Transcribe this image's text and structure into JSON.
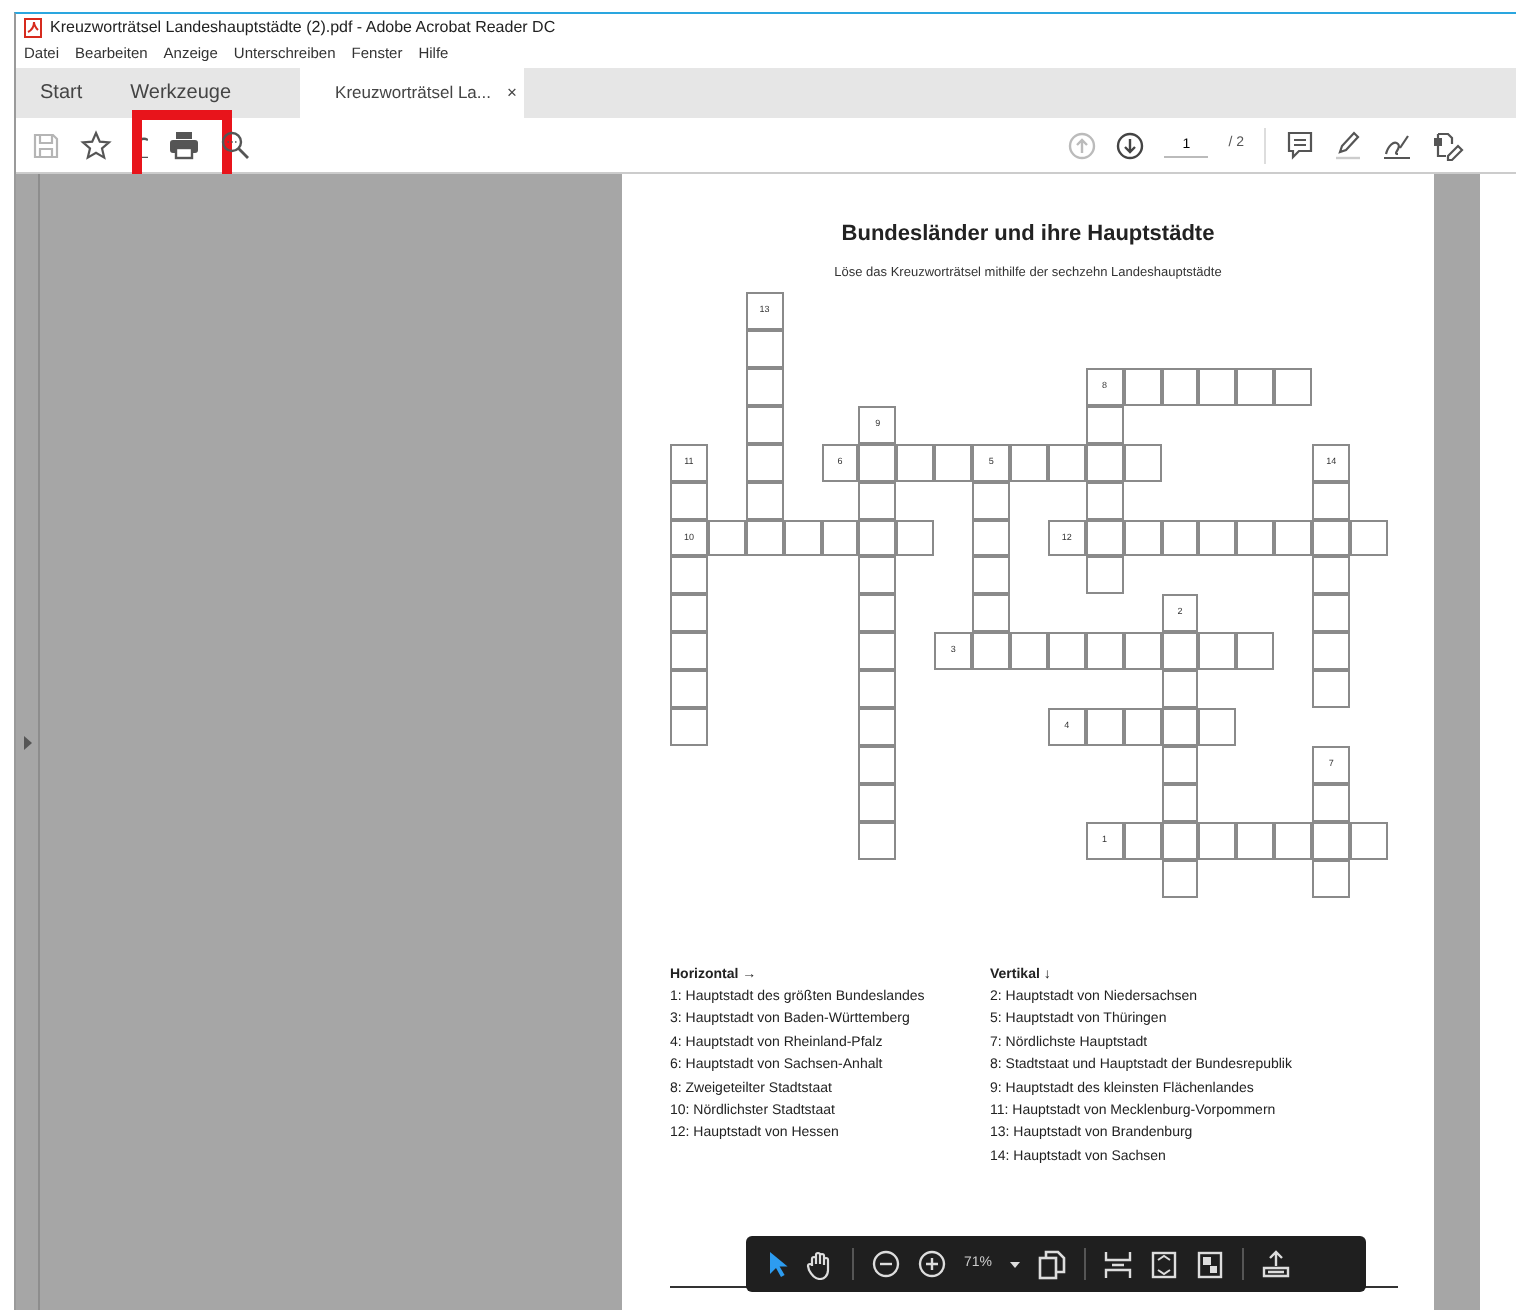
{
  "window": {
    "title": "Kreuzworträtsel Landeshauptstädte (2).pdf - Adobe Acrobat Reader DC"
  },
  "menu": [
    "Datei",
    "Bearbeiten",
    "Anzeige",
    "Unterschreiben",
    "Fenster",
    "Hilfe"
  ],
  "tabs": [
    {
      "label": "Start",
      "selected": false
    },
    {
      "label": "Werkzeuge",
      "selected": false
    },
    {
      "label": "Kreuzworträtsel La...",
      "selected": true,
      "close": "×"
    }
  ],
  "toolbar": {
    "left": [
      {
        "kind": "save",
        "disabled": true
      },
      {
        "kind": "star",
        "disabled": false
      },
      {
        "kind": "cloud",
        "disabled": false
      },
      {
        "kind": "print",
        "disabled": false,
        "highlighted": true
      },
      {
        "kind": "zoom",
        "disabled": false
      }
    ],
    "page_up": {
      "disabled": true
    },
    "page_down": {
      "disabled": false
    },
    "page": "1",
    "total": "/ 2",
    "right": [
      {
        "kind": "comment"
      },
      {
        "kind": "pen"
      },
      {
        "kind": "sign"
      },
      {
        "kind": "fill"
      }
    ]
  },
  "document": {
    "title": "Bundesländer und ihre Hauptstädte",
    "subtitle": "Löse das Kreuzworträtsel mithilfe der sechzehn Landeshauptstädte",
    "crossword": {
      "grid": [
        [
          {
            "kind": "gap"
          },
          {
            "kind": "gap"
          },
          {
            "kind": "box",
            "number": "13"
          }
        ],
        [
          {
            "kind": "gap"
          },
          {
            "kind": "gap"
          },
          {
            "kind": "box"
          }
        ],
        [
          {
            "kind": "gap"
          },
          {
            "kind": "gap"
          },
          {
            "kind": "box"
          },
          {
            "kind": "gap"
          },
          {
            "kind": "gap"
          },
          {
            "kind": "gap"
          },
          {
            "kind": "gap"
          },
          {
            "kind": "gap"
          },
          {
            "kind": "gap"
          },
          {
            "kind": "gap"
          },
          {
            "kind": "gap"
          },
          {
            "kind": "box",
            "number": "8"
          },
          {
            "kind": "box"
          },
          {
            "kind": "box"
          },
          {
            "kind": "box"
          },
          {
            "kind": "box"
          },
          {
            "kind": "box"
          }
        ],
        [
          {
            "kind": "gap"
          },
          {
            "kind": "gap"
          },
          {
            "kind": "box"
          },
          {
            "kind": "gap"
          },
          {
            "kind": "gap"
          },
          {
            "kind": "box",
            "number": "9"
          },
          {
            "kind": "gap"
          },
          {
            "kind": "gap"
          },
          {
            "kind": "gap"
          },
          {
            "kind": "gap"
          },
          {
            "kind": "gap"
          },
          {
            "kind": "box"
          }
        ],
        [
          {
            "kind": "box",
            "number": "11"
          },
          {
            "kind": "gap"
          },
          {
            "kind": "box"
          },
          {
            "kind": "gap"
          },
          {
            "kind": "box",
            "number": "6"
          },
          {
            "kind": "box"
          },
          {
            "kind": "box"
          },
          {
            "kind": "box"
          },
          {
            "kind": "box",
            "number": "5"
          },
          {
            "kind": "box"
          },
          {
            "kind": "box"
          },
          {
            "kind": "box"
          },
          {
            "kind": "box"
          },
          {
            "kind": "gap"
          },
          {
            "kind": "gap"
          },
          {
            "kind": "gap"
          },
          {
            "kind": "gap"
          },
          {
            "kind": "box",
            "number": "14"
          }
        ],
        [
          {
            "kind": "box"
          },
          {
            "kind": "gap"
          },
          {
            "kind": "box"
          },
          {
            "kind": "gap"
          },
          {
            "kind": "gap"
          },
          {
            "kind": "box"
          },
          {
            "kind": "gap"
          },
          {
            "kind": "gap"
          },
          {
            "kind": "box"
          },
          {
            "kind": "gap"
          },
          {
            "kind": "gap"
          },
          {
            "kind": "box"
          },
          {
            "kind": "gap"
          },
          {
            "kind": "gap"
          },
          {
            "kind": "gap"
          },
          {
            "kind": "gap"
          },
          {
            "kind": "gap"
          },
          {
            "kind": "box"
          }
        ],
        [
          {
            "kind": "box",
            "number": "10"
          },
          {
            "kind": "box"
          },
          {
            "kind": "box"
          },
          {
            "kind": "box"
          },
          {
            "kind": "box"
          },
          {
            "kind": "box"
          },
          {
            "kind": "box"
          },
          {
            "kind": "gap"
          },
          {
            "kind": "box"
          },
          {
            "kind": "gap"
          },
          {
            "kind": "box",
            "number": "12"
          },
          {
            "kind": "box"
          },
          {
            "kind": "box"
          },
          {
            "kind": "box"
          },
          {
            "kind": "box"
          },
          {
            "kind": "box"
          },
          {
            "kind": "box"
          },
          {
            "kind": "box"
          },
          {
            "kind": "box"
          }
        ],
        [
          {
            "kind": "box"
          },
          {
            "kind": "gap"
          },
          {
            "kind": "gap"
          },
          {
            "kind": "gap"
          },
          {
            "kind": "gap"
          },
          {
            "kind": "box"
          },
          {
            "kind": "gap"
          },
          {
            "kind": "gap"
          },
          {
            "kind": "box"
          },
          {
            "kind": "gap"
          },
          {
            "kind": "gap"
          },
          {
            "kind": "box"
          },
          {
            "kind": "gap"
          },
          {
            "kind": "gap"
          },
          {
            "kind": "gap"
          },
          {
            "kind": "gap"
          },
          {
            "kind": "gap"
          },
          {
            "kind": "box"
          }
        ],
        [
          {
            "kind": "box"
          },
          {
            "kind": "gap"
          },
          {
            "kind": "gap"
          },
          {
            "kind": "gap"
          },
          {
            "kind": "gap"
          },
          {
            "kind": "box"
          },
          {
            "kind": "gap"
          },
          {
            "kind": "gap"
          },
          {
            "kind": "box"
          },
          {
            "kind": "gap"
          },
          {
            "kind": "gap"
          },
          {
            "kind": "gap"
          },
          {
            "kind": "gap"
          },
          {
            "kind": "box",
            "number": "2"
          },
          {
            "kind": "gap"
          },
          {
            "kind": "gap"
          },
          {
            "kind": "gap"
          },
          {
            "kind": "box"
          }
        ],
        [
          {
            "kind": "box"
          },
          {
            "kind": "gap"
          },
          {
            "kind": "gap"
          },
          {
            "kind": "gap"
          },
          {
            "kind": "gap"
          },
          {
            "kind": "box"
          },
          {
            "kind": "gap"
          },
          {
            "kind": "box",
            "number": "3"
          },
          {
            "kind": "box"
          },
          {
            "kind": "box"
          },
          {
            "kind": "box"
          },
          {
            "kind": "box"
          },
          {
            "kind": "box"
          },
          {
            "kind": "box"
          },
          {
            "kind": "box"
          },
          {
            "kind": "box"
          },
          {
            "kind": "gap"
          },
          {
            "kind": "box"
          }
        ],
        [
          {
            "kind": "box"
          },
          {
            "kind": "gap"
          },
          {
            "kind": "gap"
          },
          {
            "kind": "gap"
          },
          {
            "kind": "gap"
          },
          {
            "kind": "box"
          },
          {
            "kind": "gap"
          },
          {
            "kind": "gap"
          },
          {
            "kind": "gap"
          },
          {
            "kind": "gap"
          },
          {
            "kind": "gap"
          },
          {
            "kind": "gap"
          },
          {
            "kind": "gap"
          },
          {
            "kind": "box"
          },
          {
            "kind": "gap"
          },
          {
            "kind": "gap"
          },
          {
            "kind": "gap"
          },
          {
            "kind": "box"
          }
        ],
        [
          {
            "kind": "box"
          },
          {
            "kind": "gap"
          },
          {
            "kind": "gap"
          },
          {
            "kind": "gap"
          },
          {
            "kind": "gap"
          },
          {
            "kind": "box"
          },
          {
            "kind": "gap"
          },
          {
            "kind": "gap"
          },
          {
            "kind": "gap"
          },
          {
            "kind": "gap"
          },
          {
            "kind": "box",
            "number": "4"
          },
          {
            "kind": "box"
          },
          {
            "kind": "box"
          },
          {
            "kind": "box"
          },
          {
            "kind": "box"
          }
        ],
        [
          {
            "kind": "gap"
          },
          {
            "kind": "gap"
          },
          {
            "kind": "gap"
          },
          {
            "kind": "gap"
          },
          {
            "kind": "gap"
          },
          {
            "kind": "box"
          },
          {
            "kind": "gap"
          },
          {
            "kind": "gap"
          },
          {
            "kind": "gap"
          },
          {
            "kind": "gap"
          },
          {
            "kind": "gap"
          },
          {
            "kind": "gap"
          },
          {
            "kind": "gap"
          },
          {
            "kind": "box"
          },
          {
            "kind": "gap"
          },
          {
            "kind": "gap"
          },
          {
            "kind": "gap"
          },
          {
            "kind": "box",
            "number": "7"
          }
        ],
        [
          {
            "kind": "gap"
          },
          {
            "kind": "gap"
          },
          {
            "kind": "gap"
          },
          {
            "kind": "gap"
          },
          {
            "kind": "gap"
          },
          {
            "kind": "box"
          },
          {
            "kind": "gap"
          },
          {
            "kind": "gap"
          },
          {
            "kind": "gap"
          },
          {
            "kind": "gap"
          },
          {
            "kind": "gap"
          },
          {
            "kind": "gap"
          },
          {
            "kind": "gap"
          },
          {
            "kind": "box"
          },
          {
            "kind": "gap"
          },
          {
            "kind": "gap"
          },
          {
            "kind": "gap"
          },
          {
            "kind": "box"
          }
        ],
        [
          {
            "kind": "gap"
          },
          {
            "kind": "gap"
          },
          {
            "kind": "gap"
          },
          {
            "kind": "gap"
          },
          {
            "kind": "gap"
          },
          {
            "kind": "box"
          },
          {
            "kind": "gap"
          },
          {
            "kind": "gap"
          },
          {
            "kind": "gap"
          },
          {
            "kind": "gap"
          },
          {
            "kind": "gap"
          },
          {
            "kind": "box",
            "number": "1"
          },
          {
            "kind": "box"
          },
          {
            "kind": "box"
          },
          {
            "kind": "box"
          },
          {
            "kind": "box"
          },
          {
            "kind": "box"
          },
          {
            "kind": "box"
          },
          {
            "kind": "box"
          }
        ],
        [
          {
            "kind": "gap"
          },
          {
            "kind": "gap"
          },
          {
            "kind": "gap"
          },
          {
            "kind": "gap"
          },
          {
            "kind": "gap"
          },
          {
            "kind": "gap"
          },
          {
            "kind": "gap"
          },
          {
            "kind": "gap"
          },
          {
            "kind": "gap"
          },
          {
            "kind": "gap"
          },
          {
            "kind": "gap"
          },
          {
            "kind": "gap"
          },
          {
            "kind": "gap"
          },
          {
            "kind": "box"
          },
          {
            "kind": "gap"
          },
          {
            "kind": "gap"
          },
          {
            "kind": "gap"
          },
          {
            "kind": "box"
          }
        ]
      ]
    },
    "clues": [
      {
        "heading": "Horizontal →",
        "items": [
          "1: Hauptstadt des größten Bundeslandes",
          "3: Hauptstadt von Baden-Württemberg",
          "4: Hauptstadt von Rheinland-Pfalz",
          "6: Hauptstadt von Sachsen-Anhalt",
          "8: Zweigeteilter Stadtstaat",
          "10: Nördlichster Stadtstaat",
          "12: Hauptstadt von Hessen"
        ]
      },
      {
        "heading": "Vertikal ↓",
        "items": [
          "2: Hauptstadt von Niedersachsen",
          "5: Hauptstadt von Thüringen",
          "7: Nördlichste Hauptstadt",
          "8: Stadtstaat und Hauptstadt der Bundesrepublik",
          "9: Hauptstadt des kleinsten Flächenlandes",
          "11: Hauptstadt von Mecklenburg-Vorpommern",
          "13: Hauptstadt von Brandenburg",
          "14: Hauptstadt von Sachsen"
        ]
      }
    ]
  },
  "bottom_toolbar": {
    "tools": [
      {
        "kind": "select",
        "selected": true
      },
      {
        "kind": "hand",
        "selected": false
      }
    ],
    "zoom": "71%"
  }
}
